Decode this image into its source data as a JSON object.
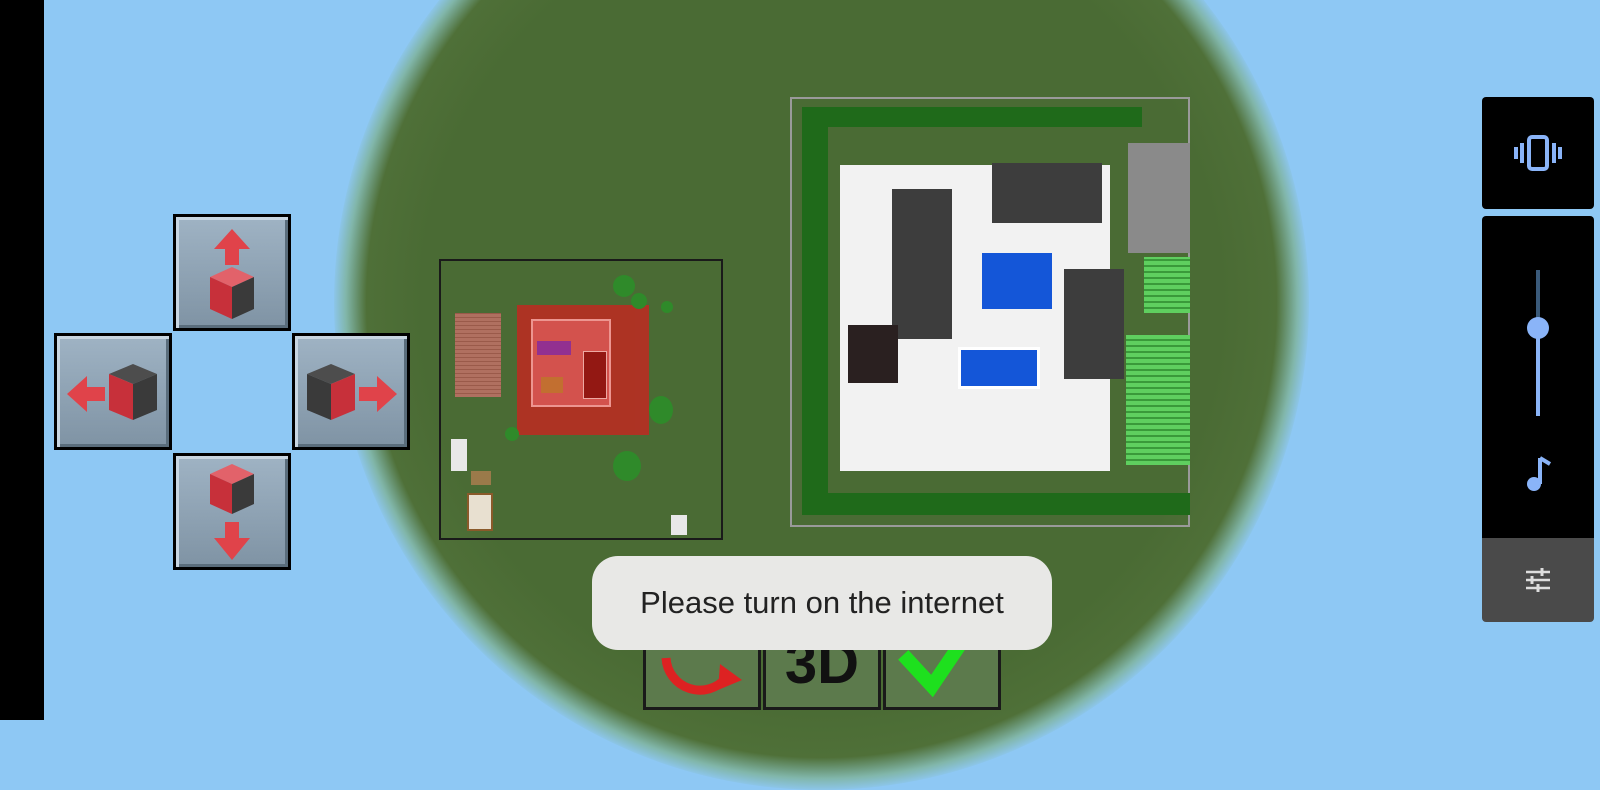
{
  "toast": {
    "message": "Please turn on the internet"
  },
  "controls": {
    "dpad": [
      "move-up",
      "move-left",
      "move-right",
      "move-down"
    ],
    "bottom": [
      "rotate",
      "3D",
      "confirm"
    ],
    "label_3d": "3D"
  },
  "volume_panel": {
    "level": 0.6
  },
  "colors": {
    "sky": "#8ec8f4",
    "grass": "#4a6b34",
    "arrow": "#e0434a",
    "confirm": "#1ee01e",
    "accent": "#8ab4f8"
  }
}
